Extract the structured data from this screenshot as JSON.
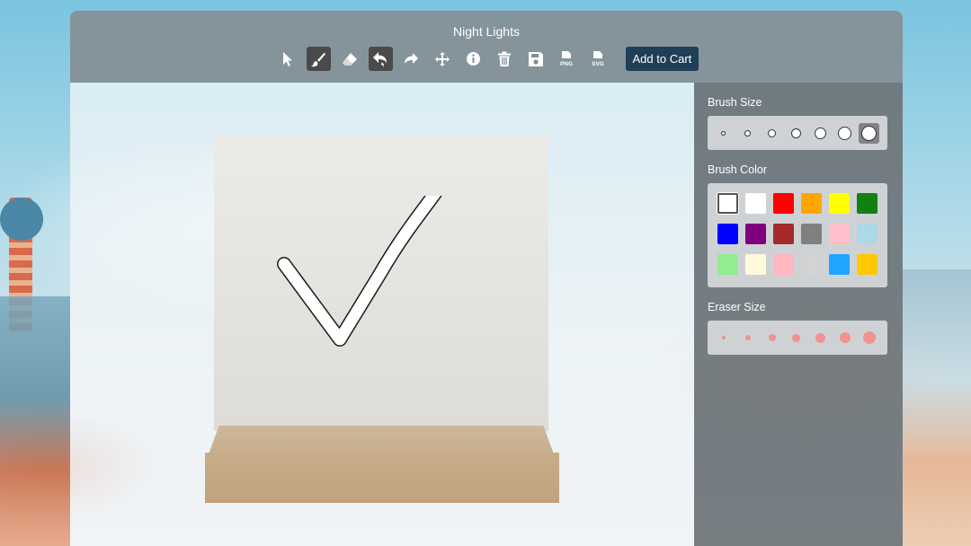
{
  "app": {
    "title": "Night Lights"
  },
  "toolbar": {
    "tools": [
      {
        "name": "select",
        "icon": "pointer-icon",
        "active": false
      },
      {
        "name": "brush",
        "icon": "brush-icon",
        "active": true
      },
      {
        "name": "eraser",
        "icon": "eraser-icon",
        "active": false
      },
      {
        "name": "undo",
        "icon": "undo-icon",
        "active": true
      },
      {
        "name": "redo",
        "icon": "redo-icon",
        "active": false
      },
      {
        "name": "move",
        "icon": "move-icon",
        "active": false
      },
      {
        "name": "info",
        "icon": "info-icon",
        "active": false
      },
      {
        "name": "delete",
        "icon": "trash-icon",
        "active": false
      },
      {
        "name": "save",
        "icon": "save-icon",
        "active": false
      },
      {
        "name": "export-png",
        "icon": "png-file-icon",
        "active": false,
        "label": "PNG"
      },
      {
        "name": "export-svg",
        "icon": "svg-file-icon",
        "active": false,
        "label": "SVG"
      }
    ],
    "add_to_cart_label": "Add to Cart"
  },
  "panel": {
    "brush_size": {
      "heading": "Brush Size",
      "selected_index": 6,
      "options": 7
    },
    "brush_color": {
      "heading": "Brush Color",
      "selected_index": 0,
      "colors": [
        "#ffffff",
        "#ffffff",
        "#ff0000",
        "#ffa500",
        "#ffff00",
        "#138013",
        "#0000ff",
        "#800080",
        "#a52a2a",
        "#808080",
        "#ffc0cb",
        "#add8e6",
        "#90ee90",
        "#fffadc",
        "#ffb6c1",
        "#d3d3d3",
        "#1ea5ff",
        "#ffc800"
      ]
    },
    "eraser_size": {
      "heading": "Eraser Size",
      "options": 7,
      "color": "#f1928f"
    }
  },
  "canvas": {
    "stroke_color": "#ffffff",
    "drawing": "checkmark"
  }
}
